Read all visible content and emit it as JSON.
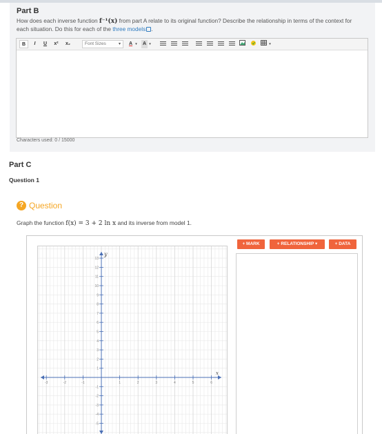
{
  "part_b": {
    "title": "Part B",
    "prompt_pre": "How does each inverse function ",
    "prompt_fn": "f⁻¹(x)",
    "prompt_mid": " from part A relate to its original function? Describe the relationship in terms of the context for each situation. Do this for each of the ",
    "prompt_link": "three models",
    "prompt_end": ".",
    "toolbar": {
      "bold": "B",
      "italic": "I",
      "underline": "U",
      "superscript": "x²",
      "subscript": "x₂",
      "font_sizes": "Font Sizes",
      "font_color": "A",
      "bg_color": "A"
    },
    "counter": "Characters used: 0 / 15000"
  },
  "part_c": {
    "title": "Part C",
    "question_number": "Question 1"
  },
  "question": {
    "label": "Question",
    "icon_glyph": "?",
    "prompt_pre": "Graph the function ",
    "prompt_math": "f(x) = 3 + 2 ln x",
    "prompt_post": " and its inverse from model 1."
  },
  "graph_tool": {
    "buttons": {
      "mark": "+ MARK",
      "relationship": "+ RELATIONSHIP ▾",
      "data": "+ DATA"
    },
    "axis_x_label": "x",
    "axis_y_label": "y",
    "x_tick_labels": [
      "-3",
      "-2",
      "-1",
      "1",
      "2",
      "3",
      "4",
      "5",
      "6"
    ],
    "y_tick_labels": [
      "13",
      "12",
      "11",
      "10",
      "9",
      "8",
      "7",
      "6",
      "5",
      "4",
      "3",
      "2",
      "1",
      "-1",
      "-2",
      "-3",
      "-4",
      "-5"
    ],
    "colors": {
      "accent": "#f0643c",
      "question_icon": "#f5a623",
      "link": "#2f7bbf",
      "grid": "#e8e8e8",
      "axis": "#4a6fb5"
    }
  }
}
